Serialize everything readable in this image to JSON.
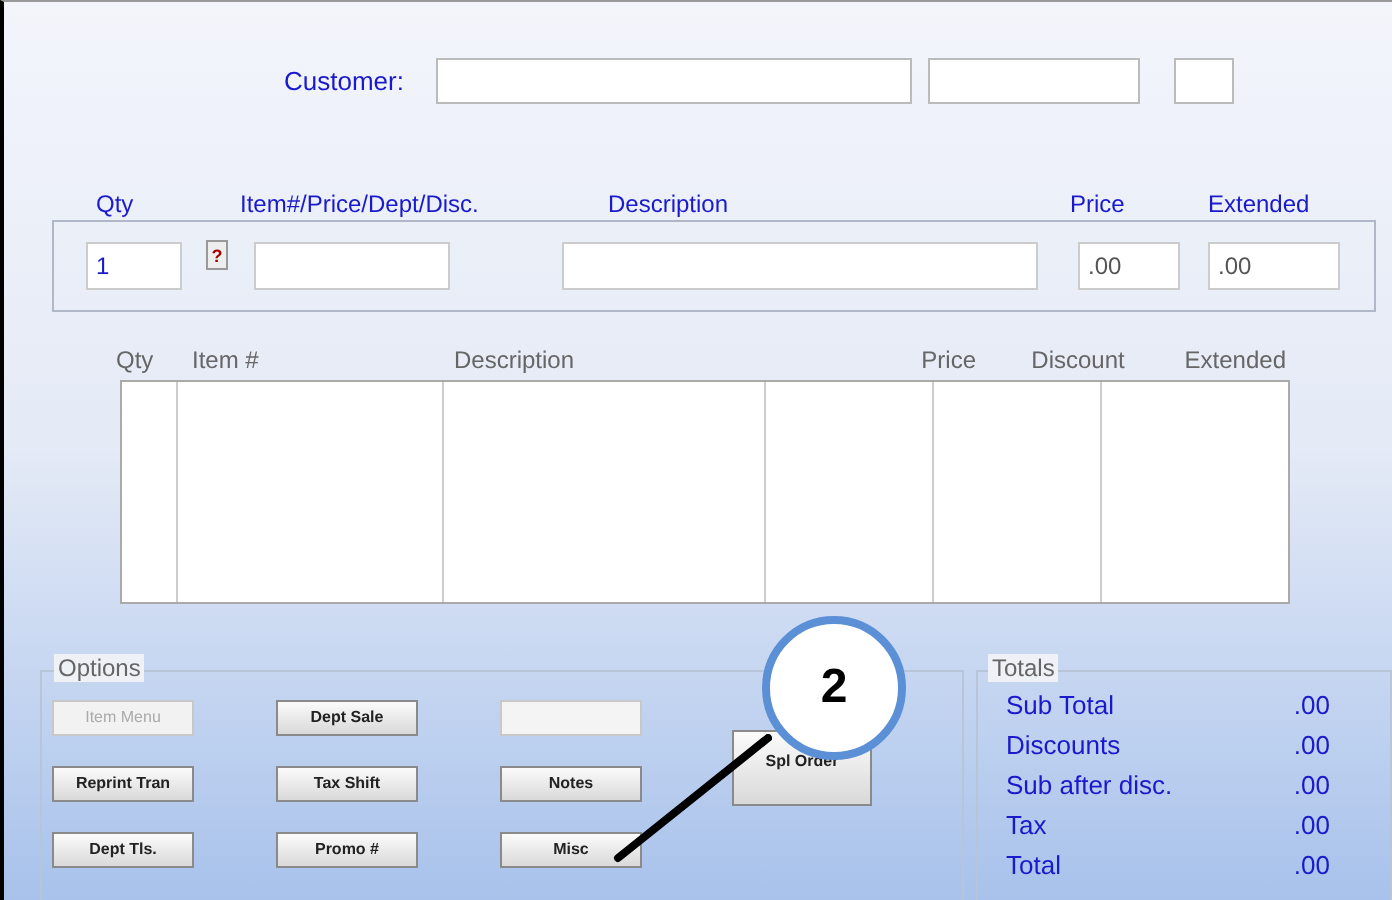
{
  "customer": {
    "label": "Customer:"
  },
  "entry": {
    "headers": [
      "Qty",
      "Item#/Price/Dept/Disc.",
      "Description",
      "Price",
      "Extended"
    ],
    "qty": "1",
    "lookup_button": "?",
    "price": ".00",
    "extended": ".00"
  },
  "grid": {
    "columns": [
      "Qty",
      "Item #",
      "Description",
      "Price",
      "Discount",
      "Extended"
    ]
  },
  "options": {
    "title": "Options",
    "buttons": [
      {
        "kind": "button",
        "label": "Item Menu",
        "disabled": true
      },
      {
        "kind": "button",
        "label": "Dept Sale",
        "disabled": false
      },
      {
        "kind": "blank"
      },
      {
        "kind": "button",
        "label": "Reprint Tran",
        "disabled": false
      },
      {
        "kind": "button",
        "label": "Tax Shift",
        "disabled": false
      },
      {
        "kind": "button",
        "label": "Notes",
        "disabled": false
      },
      {
        "kind": "button",
        "label": "Dept Tls.",
        "disabled": false
      },
      {
        "kind": "button",
        "label": "Promo #",
        "disabled": false
      },
      {
        "kind": "button",
        "label": "Misc",
        "disabled": false
      }
    ],
    "side_button": {
      "label": "Spl Order",
      "disabled": false
    }
  },
  "totals": {
    "title": "Totals",
    "rows": [
      {
        "label": "Sub Total",
        "value": ".00"
      },
      {
        "label": "Discounts",
        "value": ".00"
      },
      {
        "label": "Sub after disc.",
        "value": ".00"
      },
      {
        "label": "Tax",
        "value": ".00"
      },
      {
        "label": "Total",
        "value": ".00"
      }
    ]
  },
  "callout": {
    "number": "2"
  }
}
